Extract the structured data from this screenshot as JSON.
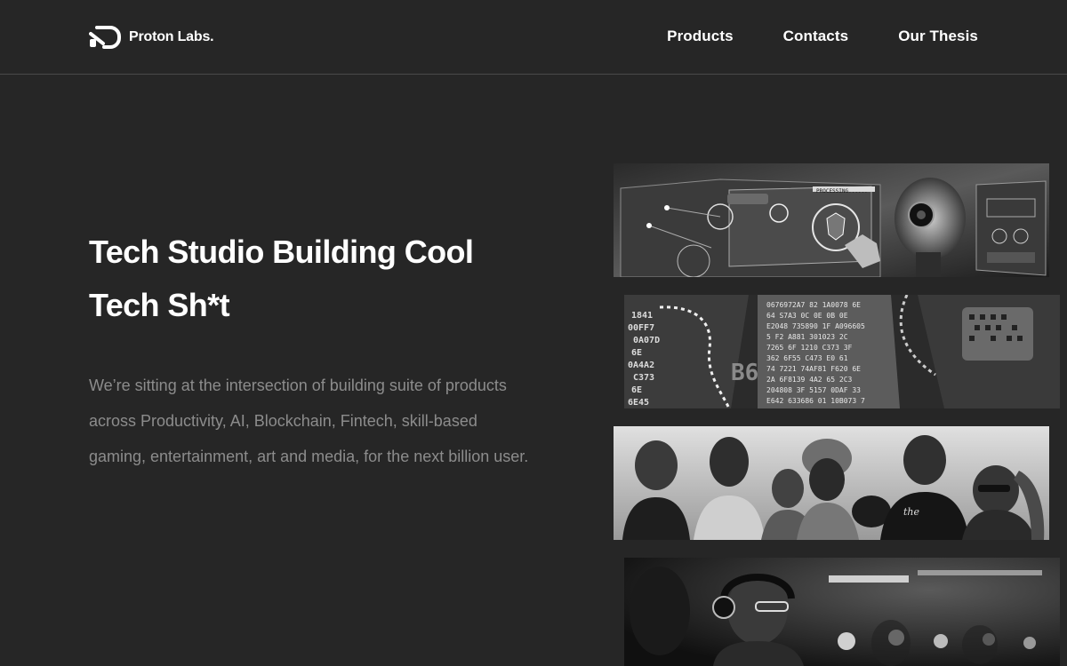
{
  "brand": {
    "name": "Proton Labs."
  },
  "nav": {
    "items": [
      {
        "label": "Products"
      },
      {
        "label": "Contacts"
      },
      {
        "label": "Our Thesis"
      }
    ]
  },
  "hero": {
    "title": "Tech Studio Building Cool Tech Sh*t",
    "description": "We’re sitting at the intersection of building suite of products across Productivity, AI, Blockchain, Fintech, skill-based gaming, entertainment, art and media, for the next billion user."
  },
  "strips": {
    "tech_label": "PROCESSING......"
  },
  "colors": {
    "background": "#262626",
    "text": "#ffffff",
    "muted_text": "#8c8c8c",
    "divider": "#4a4a4a"
  }
}
